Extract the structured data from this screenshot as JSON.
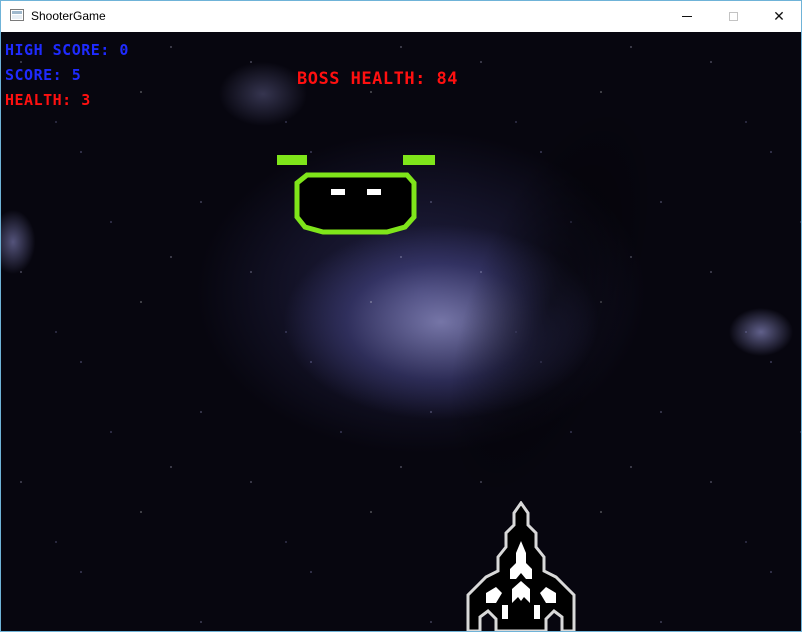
{
  "window": {
    "title": "ShooterGame",
    "controls": {
      "minimize": "minimize",
      "maximize": "maximize",
      "close": "close"
    }
  },
  "hud": {
    "high_score_label": "HIGH SCORE: 0",
    "score_label": "SCORE: 5",
    "health_label": "HEALTH: 3",
    "boss_health_label": "BOSS HEALTH: 84"
  },
  "colors": {
    "score_text": "#1f2bff",
    "health_text": "#ff1010",
    "boss_outline": "#7fe51a",
    "player_outline": "#d9d9d9",
    "space_bg": "#07060f"
  },
  "sprites": {
    "boss_icon": "green-alien-boss",
    "player_icon": "player-spaceship"
  }
}
